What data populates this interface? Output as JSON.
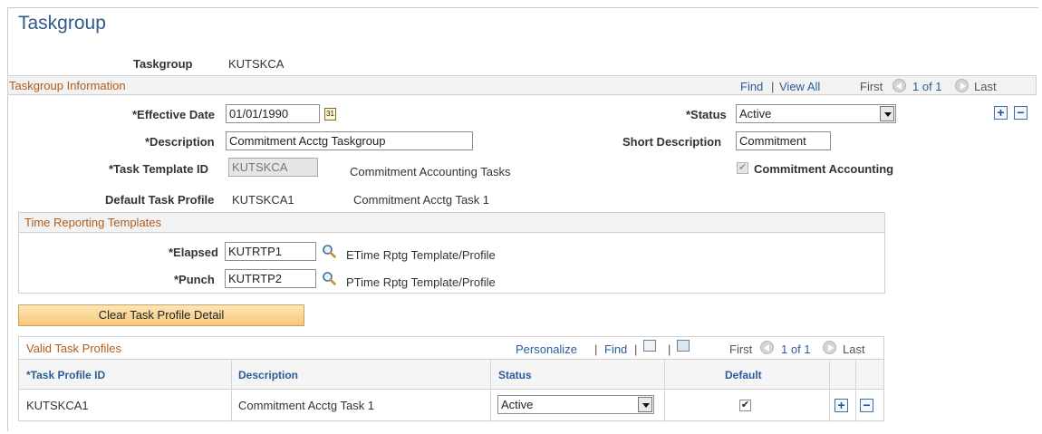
{
  "page": {
    "title": "Taskgroup"
  },
  "header": {
    "taskgroup_label": "Taskgroup",
    "taskgroup_value": "KUTSKCA"
  },
  "info_section": {
    "title": "Taskgroup Information",
    "find": "Find",
    "separator": "|",
    "view_all": "View All",
    "first": "First",
    "counter": "1 of 1",
    "last": "Last"
  },
  "fields": {
    "effective_date_label": "*Effective Date",
    "effective_date_value": "01/01/1990",
    "calendar_icon_text": "31",
    "status_label": "*Status",
    "status_value": "Active",
    "description_label": "*Description",
    "description_value": "Commitment Acctg Taskgroup",
    "short_description_label": "Short Description",
    "short_description_value": "Commitment",
    "task_template_label": "*Task Template ID",
    "task_template_value": "KUTSKCA",
    "task_template_desc": "Commitment Accounting Tasks",
    "commitment_accounting_label": "Commitment Accounting",
    "commitment_accounting_checked": "✔",
    "default_task_profile_label": "Default Task Profile",
    "default_task_profile_value": "KUTSKCA1",
    "default_task_profile_desc": "Commitment Acctg Task 1"
  },
  "time_reporting": {
    "title": "Time Reporting Templates",
    "elapsed_label": "*Elapsed",
    "elapsed_value": "KUTRTP1",
    "elapsed_desc": "ETime Rptg Template/Profile",
    "punch_label": "*Punch",
    "punch_value": "KUTRTP2",
    "punch_desc": "PTime Rptg Template/Profile"
  },
  "buttons": {
    "clear_task_profile": "Clear Task Profile Detail",
    "add": "+",
    "delete": "−"
  },
  "valid_profiles": {
    "title": "Valid Task Profiles",
    "personalize": "Personalize",
    "find": "Find",
    "separator": "|",
    "first": "First",
    "counter": "1 of 1",
    "last": "Last",
    "columns": {
      "id": "*Task Profile ID",
      "description": "Description",
      "status": "Status",
      "default": "Default"
    },
    "rows": [
      {
        "id": "KUTSKCA1",
        "description": "Commitment Acctg Task 1",
        "status": "Active",
        "default_mark": "✔"
      }
    ]
  },
  "icons": {
    "prev": "previous-icon",
    "next": "next-icon",
    "lookup": "search-icon",
    "calendar": "calendar-icon",
    "zoom": "zoom-icon",
    "download": "download-icon"
  },
  "colors": {
    "title": "#2f5b8a",
    "section": "#b05b1a",
    "link": "#2a5c99",
    "button": "#f6c877"
  }
}
